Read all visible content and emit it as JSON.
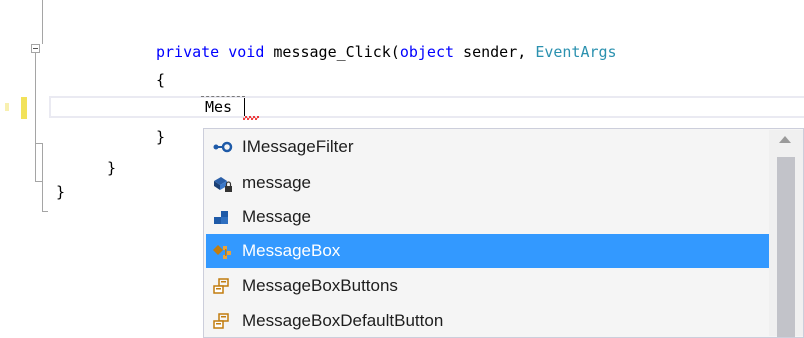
{
  "code": {
    "kw_private": "private",
    "kw_void": "void",
    "method_name": " message_Click(",
    "kw_object": "object",
    "param_sender": " sender, ",
    "type_eventargs": "EventArgs",
    "open_brace": "{",
    "typed_text": "Mes",
    "close_brace_method": "}",
    "close_brace_class": "}",
    "close_brace_namespace": "}"
  },
  "completion": {
    "items": [
      {
        "label": "IMessageFilter",
        "icon": "interface-icon"
      },
      {
        "label": "message",
        "icon": "private-field-icon"
      },
      {
        "label": "Message",
        "icon": "struct-icon"
      },
      {
        "label": "MessageBox",
        "icon": "class-icon"
      },
      {
        "label": "MessageBoxButtons",
        "icon": "enum-icon"
      },
      {
        "label": "MessageBoxDefaultButton",
        "icon": "enum-icon"
      }
    ],
    "selected_index": 3
  },
  "colors": {
    "keyword": "#0000ff",
    "type": "#2b91af",
    "selection": "#3399ff"
  }
}
